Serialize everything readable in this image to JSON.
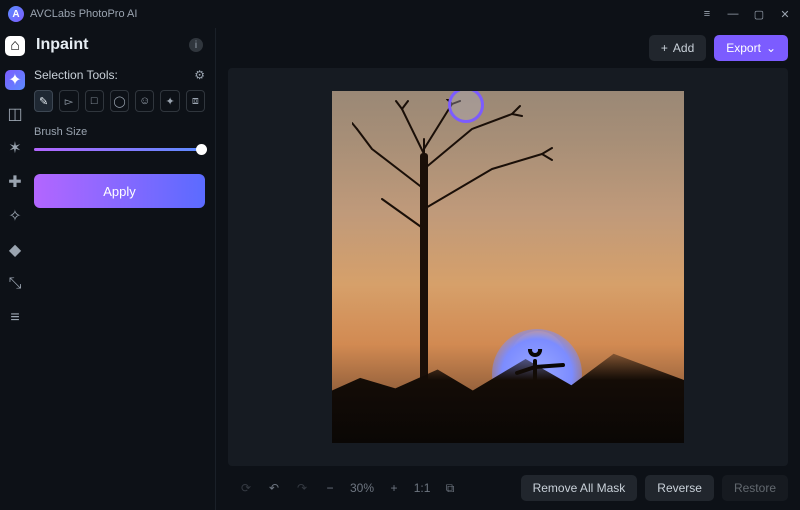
{
  "app": {
    "title": "AVCLabs PhotoPro AI",
    "logo_letter": "A"
  },
  "window_controls": {
    "menu": "≡",
    "min": "—",
    "max": "▢",
    "close": "✕"
  },
  "rail": {
    "items": [
      {
        "name": "home-icon",
        "glyph": "⌂"
      },
      {
        "name": "inpaint-icon",
        "glyph": "✦"
      },
      {
        "name": "mask-icon",
        "glyph": "◫"
      },
      {
        "name": "sparkle-icon",
        "glyph": "✶"
      },
      {
        "name": "puzzle-icon",
        "glyph": "✚"
      },
      {
        "name": "crop-icon",
        "glyph": "✧"
      },
      {
        "name": "bucket-icon",
        "glyph": "◆"
      },
      {
        "name": "resize-icon",
        "glyph": "⤡"
      },
      {
        "name": "sliders-icon",
        "glyph": "≡"
      }
    ]
  },
  "panel": {
    "title": "Inpaint",
    "selection_label": "Selection Tools:",
    "brush_label": "Brush Size",
    "apply_label": "Apply",
    "tools": [
      {
        "name": "brush-tool",
        "glyph": "✎",
        "active": true
      },
      {
        "name": "pointer-tool",
        "glyph": "▻"
      },
      {
        "name": "rect-tool",
        "glyph": "□"
      },
      {
        "name": "ellipse-tool",
        "glyph": "◯"
      },
      {
        "name": "person-tool",
        "glyph": "☺"
      },
      {
        "name": "magic-tool",
        "glyph": "✦"
      },
      {
        "name": "select-all-tool",
        "glyph": "⧈"
      }
    ],
    "brush_size_pct": 100
  },
  "topbar": {
    "add_label": "Add",
    "export_label": "Export"
  },
  "bottombar": {
    "zoom_pct": "30%",
    "remove_mask_label": "Remove All Mask",
    "reverse_label": "Reverse",
    "restore_label": "Restore"
  }
}
